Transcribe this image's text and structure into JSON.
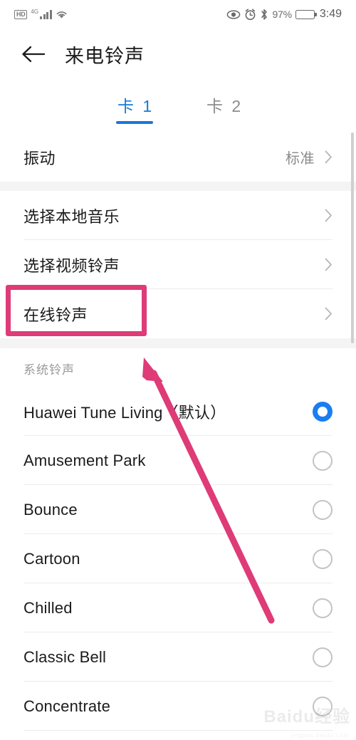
{
  "statusbar": {
    "hd_badge": "HD",
    "network": "4G",
    "battery_percent": "97%",
    "clock": "3:49",
    "icons": [
      "hd-badge",
      "signal-bars-icon",
      "wifi-icon",
      "eye-icon",
      "alarm-clock-icon",
      "bluetooth-icon",
      "battery-icon"
    ]
  },
  "header": {
    "back_icon": "back-arrow-icon",
    "title": "来电铃声"
  },
  "tabs": [
    {
      "label": "卡 1",
      "active": true
    },
    {
      "label": "卡 2",
      "active": false
    }
  ],
  "vibration_group": [
    {
      "label": "振动",
      "value": "标准",
      "chevron": true
    }
  ],
  "source_group": [
    {
      "label": "选择本地音乐",
      "chevron": true,
      "highlighted": false
    },
    {
      "label": "选择视频铃声",
      "chevron": true,
      "highlighted": false
    },
    {
      "label": "在线铃声",
      "chevron": true,
      "highlighted": true
    }
  ],
  "system_section": {
    "header": "系统铃声",
    "items": [
      {
        "label": "Huawei Tune Living（默认）",
        "selected": true
      },
      {
        "label": "Amusement Park",
        "selected": false
      },
      {
        "label": "Bounce",
        "selected": false
      },
      {
        "label": "Cartoon",
        "selected": false
      },
      {
        "label": "Chilled",
        "selected": false
      },
      {
        "label": "Classic Bell",
        "selected": false
      },
      {
        "label": "Concentrate",
        "selected": false
      }
    ]
  },
  "annotations": {
    "box_target": "在线铃声",
    "arrow_points_to": "在线铃声",
    "color": "#de3b77"
  },
  "watermark": {
    "text": "Baidu经验",
    "subtext": "jingyan.baidu.com"
  },
  "colors": {
    "accent_blue": "#1779d6",
    "radio_blue": "#1a7ef0",
    "annotation_pink": "#de3b77",
    "divider": "#ececed",
    "gap": "#f4f4f4"
  }
}
